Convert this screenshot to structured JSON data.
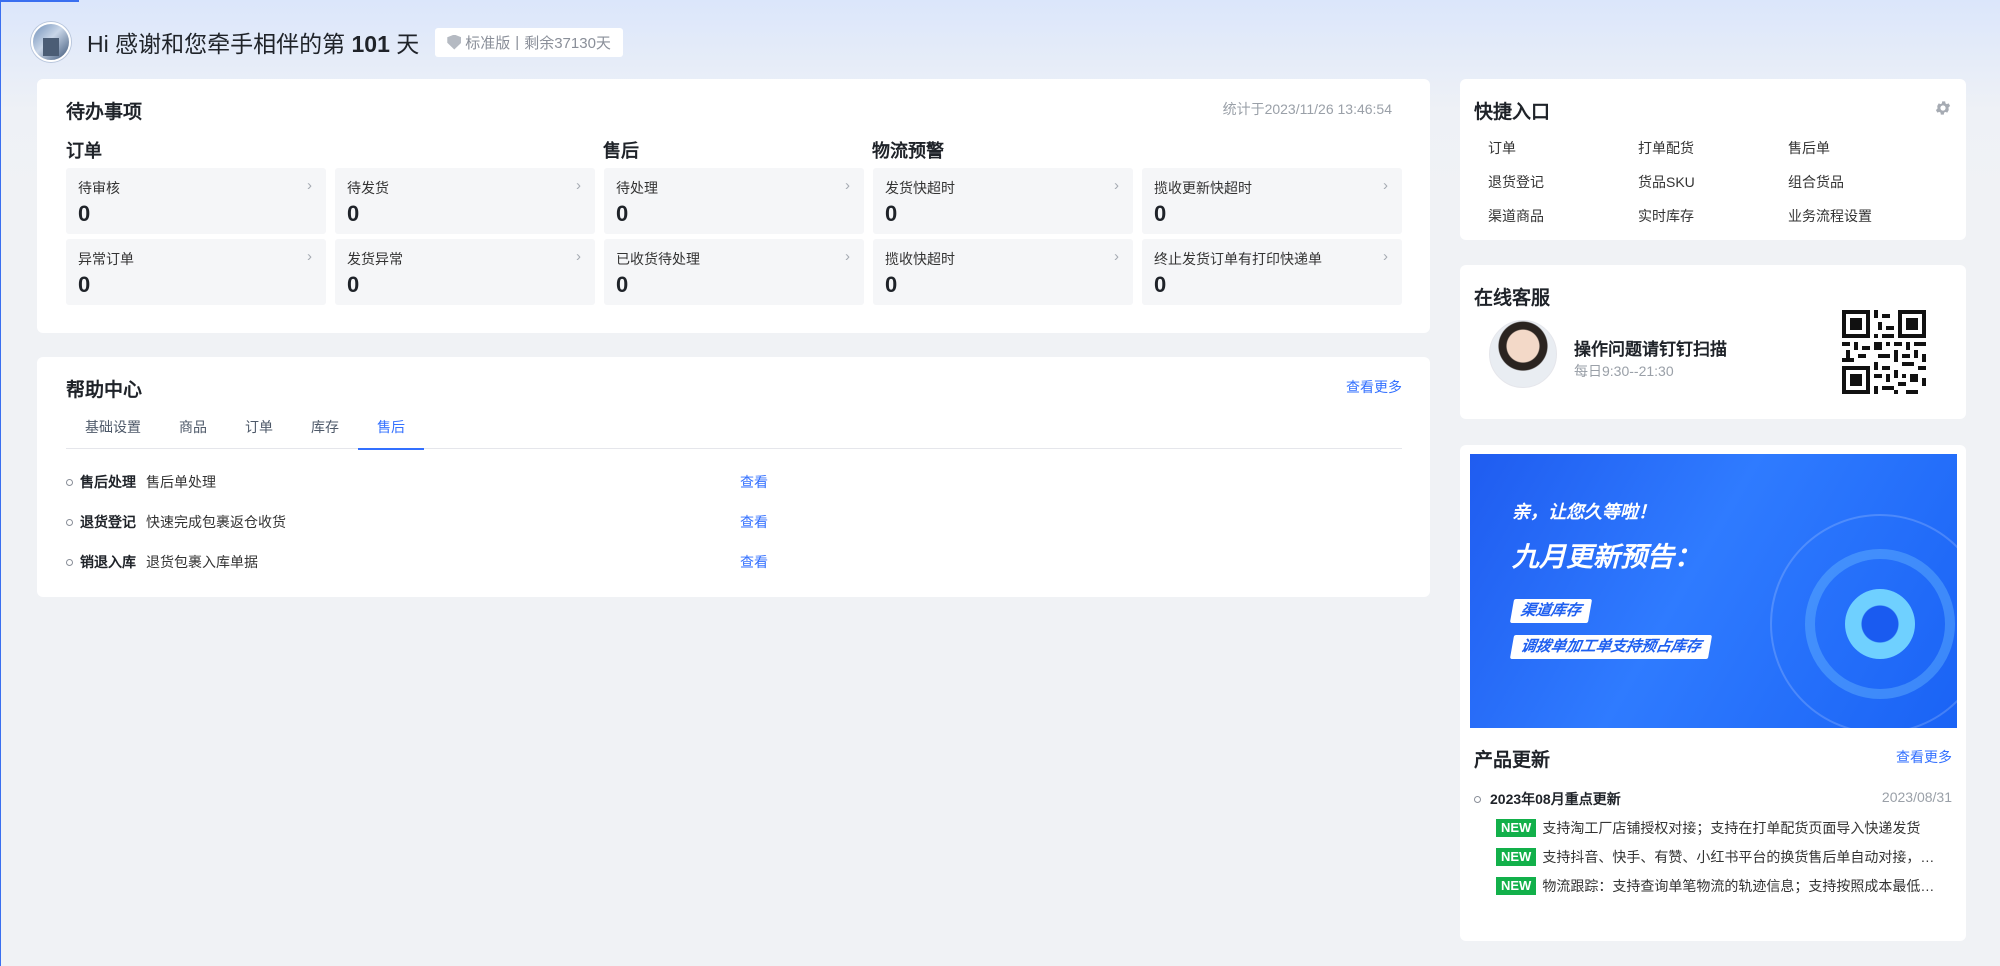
{
  "header": {
    "greeting_prefix": "Hi 感谢和您牵手相伴的第",
    "days": "101",
    "greeting_suffix": "天",
    "edition": "标准版",
    "divider": "|",
    "remaining": "剩余37130天"
  },
  "todo": {
    "title": "待办事项",
    "stat_time": "统计于2023/11/26 13:46:54",
    "groups": {
      "order": "订单",
      "aftersale": "售后",
      "logistics": "物流预警"
    },
    "cells": [
      {
        "label": "待审核",
        "value": "0"
      },
      {
        "label": "待发货",
        "value": "0"
      },
      {
        "label": "待处理",
        "value": "0"
      },
      {
        "label": "发货快超时",
        "value": "0"
      },
      {
        "label": "揽收更新快超时",
        "value": "0"
      },
      {
        "label": "异常订单",
        "value": "0"
      },
      {
        "label": "发货异常",
        "value": "0"
      },
      {
        "label": "已收货待处理",
        "value": "0"
      },
      {
        "label": "揽收快超时",
        "value": "0"
      },
      {
        "label": "终止发货订单有打印快递单",
        "value": "0"
      }
    ],
    "arrow": "›"
  },
  "help": {
    "title": "帮助中心",
    "more": "查看更多",
    "tabs": [
      "基础设置",
      "商品",
      "订单",
      "库存",
      "售后"
    ],
    "active_tab": "售后",
    "rows": [
      {
        "name": "售后处理",
        "desc": "售后单处理",
        "action": "查看"
      },
      {
        "name": "退货登记",
        "desc": "快速完成包裹返仓收货",
        "action": "查看"
      },
      {
        "name": "销退入库",
        "desc": "退货包裹入库单据",
        "action": "查看"
      }
    ]
  },
  "quick": {
    "title": "快捷入口",
    "items": [
      "订单",
      "打单配货",
      "售后单",
      "退货登记",
      "货品SKU",
      "组合货品",
      "渠道商品",
      "实时库存",
      "业务流程设置"
    ]
  },
  "service": {
    "title": "在线客服",
    "headline": "操作问题请钉钉扫描",
    "hours": "每日9:30--21:30"
  },
  "banner": {
    "line1": "亲，让您久等啦！",
    "line2": "九月更新预告：",
    "tag1": "渠道库存",
    "tag2": "调拨单加工单支持预占库存"
  },
  "news": {
    "title": "产品更新",
    "more": "查看更多",
    "entry_title": "2023年08月重点更新",
    "entry_date": "2023/08/31",
    "badge": "NEW",
    "lines": [
      "支持淘工厂店铺授权对接；支持在打单配货页面导入快递发货",
      "支持抖音、快手、有赞、小红书平台的换货售后单自动对接，…",
      "物流跟踪：支持查询单笔物流的轨迹信息；支持按照成本最低…"
    ]
  },
  "colors": {
    "accent": "#3370ff",
    "new_badge": "#12b04a",
    "banner": "#2f7bff"
  },
  "icons": {
    "gear": "gear-icon",
    "shield": "shield-icon",
    "qr": "qr-code-icon"
  }
}
